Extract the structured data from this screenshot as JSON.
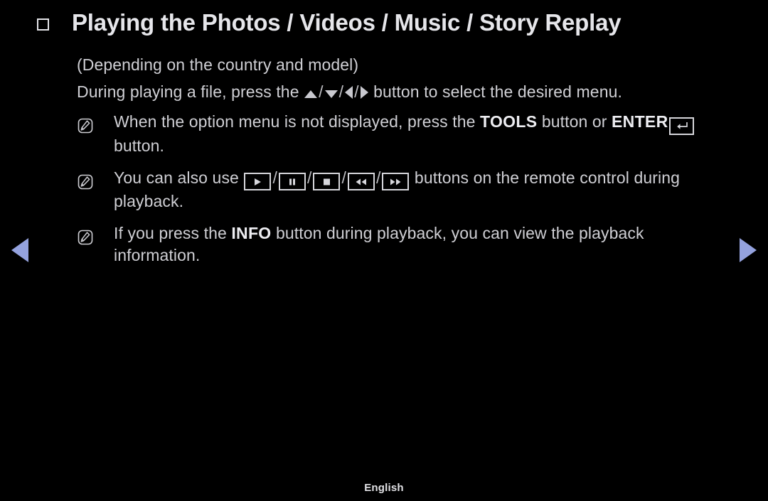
{
  "page": {
    "background_color": "#000000",
    "text_color": "#cfcfd4",
    "accent_color": "#94a2de"
  },
  "header": {
    "bullet_icon": "square-bullet-icon",
    "title": "Playing the Photos / Videos / Music / Story Replay"
  },
  "body": {
    "subtitle": "(Depending on the country and model)",
    "instruction_prefix": "During playing a file, press the ",
    "instruction_suffix": " button to select the desired menu."
  },
  "notes": [
    {
      "icon": "note-pencil-icon",
      "text_part_1": "When the option menu is not displayed, press the ",
      "keyword_1": "TOOLS",
      "text_part_2": " button or ",
      "keyword_2": "ENTER",
      "enter_glyph": "enter-return-icon",
      "text_part_3": " button."
    },
    {
      "icon": "note-pencil-icon",
      "text_part_1": "You can also use ",
      "buttons": [
        "play-icon",
        "pause-icon",
        "stop-icon",
        "rewind-icon",
        "fast-forward-icon"
      ],
      "text_part_2": " buttons on the remote control during playback."
    },
    {
      "icon": "note-pencil-icon",
      "text_part_1": "If you press the ",
      "keyword_1": "INFO",
      "text_part_2": " button during playback, you can view the playback information."
    }
  ],
  "navigation": {
    "prev_label": "previous-page-arrow",
    "next_label": "next-page-arrow"
  },
  "footer": {
    "language": "English"
  }
}
